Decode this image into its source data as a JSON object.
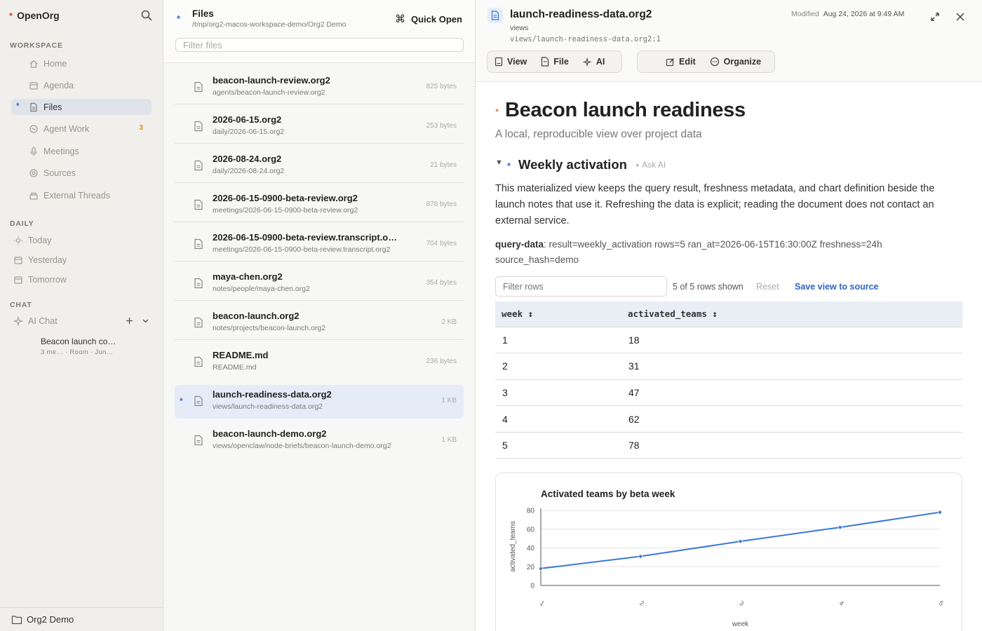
{
  "sidebar": {
    "app_name": "OpenOrg",
    "workspace_label": "WORKSPACE",
    "workspace_items": [
      {
        "label": "Home",
        "icon": "home-icon"
      },
      {
        "label": "Agenda",
        "icon": "calendar-icon"
      },
      {
        "label": "Files",
        "icon": "file-icon",
        "active": true
      },
      {
        "label": "Agent Work",
        "icon": "agent-icon",
        "badge": "3"
      },
      {
        "label": "Meetings",
        "icon": "microphone-icon"
      },
      {
        "label": "Sources",
        "icon": "sources-icon"
      },
      {
        "label": "External Threads",
        "icon": "threads-icon"
      }
    ],
    "daily_label": "DAILY",
    "daily_items": [
      {
        "label": "Today",
        "icon": "sun-icon"
      },
      {
        "label": "Yesterday",
        "icon": "calendar-icon"
      },
      {
        "label": "Tomorrow",
        "icon": "calendar-icon"
      }
    ],
    "chat_label": "CHAT",
    "chat_item": {
      "label": "AI Chat",
      "icon": "sparkle-icon"
    },
    "chat_thread": {
      "title": "Beacon launch co…",
      "meta": "3 me… · Room · Jun…"
    },
    "footer": "Org2 Demo"
  },
  "files_panel": {
    "title": "Files",
    "path": "/tmp/org2-macos-workspace-demo/Org2 Demo",
    "quick_open": "Quick Open",
    "filter_placeholder": "Filter files",
    "files": [
      {
        "name": "beacon-launch-review.org2",
        "path": "agents/beacon-launch-review.org2",
        "size": "825 bytes"
      },
      {
        "name": "2026-06-15.org2",
        "path": "daily/2026-06-15.org2",
        "size": "253 bytes"
      },
      {
        "name": "2026-08-24.org2",
        "path": "daily/2026-08-24.org2",
        "size": "21 bytes"
      },
      {
        "name": "2026-06-15-0900-beta-review.org2",
        "path": "meetings/2026-06-15-0900-beta-review.org2",
        "size": "878 bytes"
      },
      {
        "name": "2026-06-15-0900-beta-review.transcript.o…",
        "path": "meetings/2026-06-15-0900-beta-review.transcript.org2",
        "size": "704 bytes"
      },
      {
        "name": "maya-chen.org2",
        "path": "notes/people/maya-chen.org2",
        "size": "354 bytes"
      },
      {
        "name": "beacon-launch.org2",
        "path": "notes/projects/beacon-launch.org2",
        "size": "2 KB"
      },
      {
        "name": "README.md",
        "path": "README.md",
        "size": "236 bytes"
      },
      {
        "name": "launch-readiness-data.org2",
        "path": "views/launch-readiness-data.org2",
        "size": "1 KB",
        "active": true
      },
      {
        "name": "beacon-launch-demo.org2",
        "path": "views/openclaw/node-briefs/beacon-launch-demo.org2",
        "size": "1 KB"
      }
    ]
  },
  "document": {
    "filename": "launch-readiness-data.org2",
    "folder": "views",
    "location": "views/launch-readiness-data.org2:1",
    "modified_label": "Modified",
    "modified_date": "Aug 24, 2026 at 9:49 AM",
    "toolbar_left": [
      "View",
      "File",
      "AI"
    ],
    "toolbar_right": [
      "Edit",
      "Organize"
    ],
    "heading": "Beacon launch readiness",
    "subtitle": "A local, reproducible view over project data",
    "section_title": "Weekly activation",
    "ask_ai": "Ask AI",
    "paragraph": "This materialized view keeps the query result, freshness metadata, and chart definition beside the launch notes that use it. Refreshing the data is explicit; reading the document does not contact an external service.",
    "query_label": "query-data",
    "query_text": ": result=weekly_activation rows=5 ran_at=2026-06-15T16:30:00Z freshness=24h source_hash=demo",
    "filter_rows_placeholder": "Filter rows",
    "rows_shown": "5 of 5 rows shown",
    "reset": "Reset",
    "save_view": "Save view to source",
    "table": {
      "columns": [
        "week ↕",
        "activated_teams ↕"
      ],
      "rows": [
        [
          "1",
          "18"
        ],
        [
          "2",
          "31"
        ],
        [
          "3",
          "47"
        ],
        [
          "4",
          "62"
        ],
        [
          "5",
          "78"
        ]
      ]
    }
  },
  "chart_data": {
    "type": "line",
    "title": "Activated teams by beta week",
    "xlabel": "week",
    "ylabel": "activated_teams",
    "x": [
      1,
      2,
      3,
      4,
      5
    ],
    "series": [
      {
        "values": [
          18,
          31,
          47,
          62,
          78
        ],
        "color": "#3b78d4"
      }
    ],
    "ylim": [
      0,
      80
    ],
    "yticks": [
      0,
      20,
      40,
      60,
      80
    ],
    "grid": true
  }
}
